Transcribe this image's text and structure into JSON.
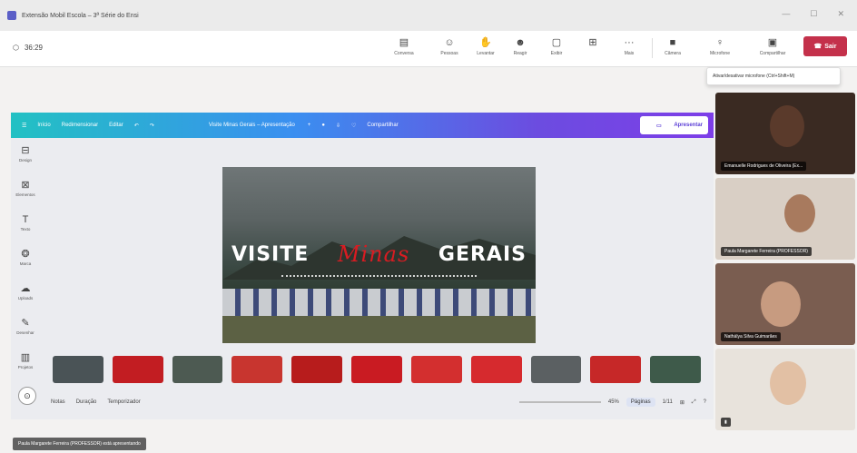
{
  "window": {
    "title": "Extensão Mobil Escola – 3ª Série do Ensi",
    "controls": [
      "—",
      "☐",
      "✕"
    ]
  },
  "meeting": {
    "timer": "36:29"
  },
  "toolbar": {
    "items": [
      {
        "icon": "chat-icon",
        "label": "Conversa"
      },
      {
        "icon": "people-icon",
        "label": "Pessoas"
      },
      {
        "icon": "raise-hand-icon",
        "label": "Levantar"
      },
      {
        "icon": "reactions-icon",
        "label": "Reagir"
      },
      {
        "icon": "view-icon",
        "label": "Exibir"
      },
      {
        "icon": "more-icon",
        "label": "Mais"
      },
      {
        "icon": "camera-icon",
        "label": "Câmera"
      },
      {
        "icon": "mic-icon",
        "label": "Microfone"
      },
      {
        "icon": "share-icon",
        "label": "Compartilhar"
      }
    ],
    "leave_label": "Sair",
    "tooltip": "Ativar/desativar microfone (Ctrl+Shift+M)"
  },
  "canva": {
    "nav": [
      "Início",
      "Redimensionar",
      "Editar"
    ],
    "doc_title": "Visite Minas Gerais – Apresentação",
    "share_label": "Compartilhar",
    "present_label": "Apresentar",
    "sidebar": [
      {
        "icon": "design-icon",
        "label": "Design"
      },
      {
        "icon": "elements-icon",
        "label": "Elementos"
      },
      {
        "icon": "text-icon",
        "label": "Texto"
      },
      {
        "icon": "brand-icon",
        "label": "Marca"
      },
      {
        "icon": "uploads-icon",
        "label": "Uploads"
      },
      {
        "icon": "draw-icon",
        "label": "Desenhar"
      },
      {
        "icon": "projects-icon",
        "label": "Projetos"
      }
    ],
    "slide": {
      "word1": "VISITE",
      "script": "Minas",
      "word2": "GERAIS"
    },
    "thumb_colors": [
      "#4a5356",
      "#c21d22",
      "#4d5a52",
      "#c8352f",
      "#b71c1c",
      "#c91b22",
      "#d32f2f",
      "#d62a2e",
      "#5b6062",
      "#c62828",
      "#3e5a4a"
    ],
    "footer_left": [
      "Notas",
      "Duração",
      "Temporizador"
    ],
    "footer_right": {
      "zoom": "45%",
      "pages": "Páginas",
      "page_count": "1/11"
    }
  },
  "participants": [
    {
      "name": "Emanuelle Rodrigues de Oliveira (Ex...",
      "bg": "#3a2a22",
      "skin": "#5a3a2b"
    },
    {
      "name": "Paula Margarete Ferreira (PROFESSOR)",
      "bg": "#d9cfc5",
      "skin": "#a87a5e"
    },
    {
      "name": "Nathálya Silva Guimarães",
      "bg": "#7a5d50",
      "skin": "#c79b80"
    },
    {
      "name": "",
      "bg": "#e8e3dc",
      "skin": "#e2c0a4"
    }
  ],
  "status_text": "Paula Margarete Ferreira (PROFESSOR) está apresentando"
}
